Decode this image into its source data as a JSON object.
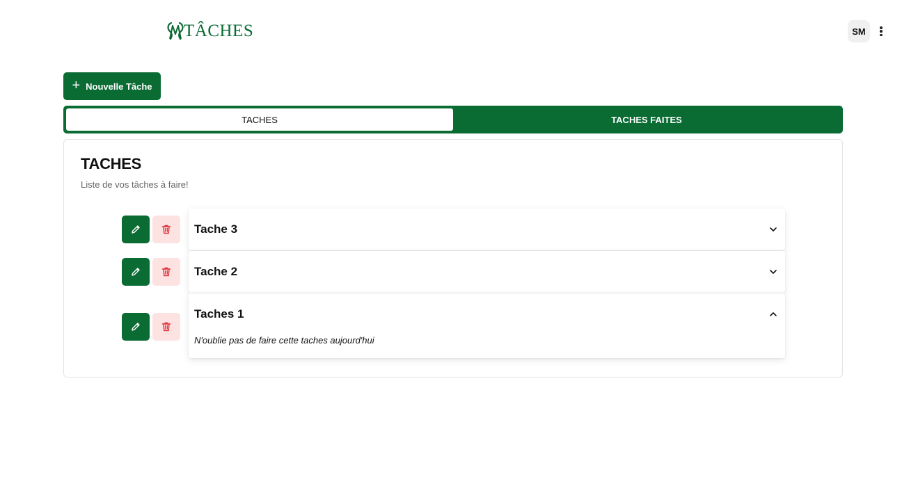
{
  "header": {
    "logo_text": "TÂCHES",
    "avatar_initials": "SM"
  },
  "toolbar": {
    "new_task_label": "Nouvelle Tâche"
  },
  "tabs": [
    {
      "label": "TACHES",
      "active": true
    },
    {
      "label": "TACHES FAITES",
      "active": false
    }
  ],
  "main": {
    "title": "TACHES",
    "subtitle": "Liste de vos tâches à faire!",
    "tasks": [
      {
        "title": "Tache 3",
        "expanded": false,
        "description": ""
      },
      {
        "title": "Tache 2",
        "expanded": false,
        "description": ""
      },
      {
        "title": "Taches 1",
        "expanded": true,
        "description": "N'oublie pas de faire cette taches aujourd'hui"
      }
    ]
  },
  "colors": {
    "brand_green": "#0a6b33",
    "delete_bg": "#fde2e2",
    "delete_icon": "#e0323a"
  },
  "icons": [
    "plus-icon",
    "pencil-icon",
    "trash-icon",
    "chevron-down-icon",
    "chevron-up-icon",
    "more-vertical-icon"
  ]
}
